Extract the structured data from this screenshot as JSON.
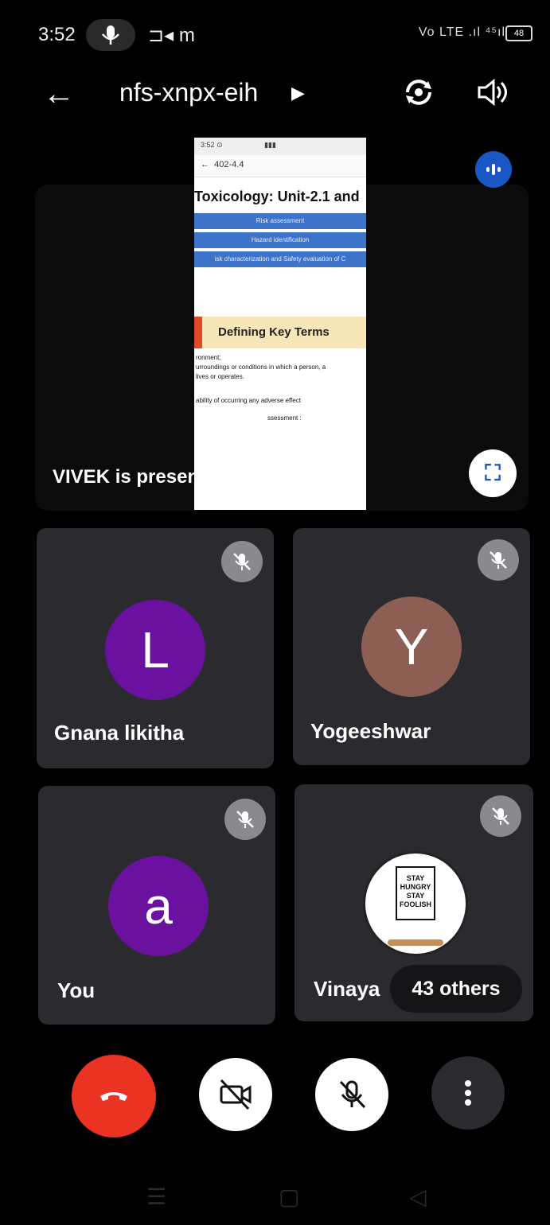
{
  "status_bar": {
    "time": "3:52",
    "recording_glyph": "m",
    "network": "Vo LTE .ıl ⁴⁵ıl",
    "battery": "48"
  },
  "header": {
    "meeting_code": "nfs-xnpx-eih",
    "icons": [
      "back-arrow-icon",
      "switch-camera-icon",
      "speaker-icon"
    ]
  },
  "presentation": {
    "presenter_label": "VIVEK is presenting",
    "shared_screen": {
      "nav_text": "402-4.4",
      "title": "Toxicology: Unit-2.1 and",
      "bars": [
        "Risk assessment",
        "Hazard identification",
        "isk characterization and Safety    evaluation of C"
      ],
      "heading": "Defining Key Terms",
      "lines": [
        "ronment;",
        "urroundings  or conditions in which a person, a",
        " lives or operates.",
        "ability of occurring any adverse effect",
        "ssessment :"
      ]
    }
  },
  "participants": [
    {
      "name": "Gnana likitha",
      "initial": "L",
      "color": "#6a11a0"
    },
    {
      "name": "Yogeeshwar",
      "initial": "Y",
      "color": "#8d5f54"
    },
    {
      "name": "You",
      "initial": "a",
      "color": "#6a11a0"
    },
    {
      "name": "Vinaya",
      "initial": "",
      "color": "#ffffff",
      "avatar_text": "STAY HUNGRY STAY FOOLISH"
    }
  ],
  "others_badge": "43 others",
  "controls": {
    "end_call_color": "#ea3323",
    "items": [
      "end-call-button",
      "camera-off-button",
      "mic-off-button",
      "more-options-button"
    ]
  }
}
